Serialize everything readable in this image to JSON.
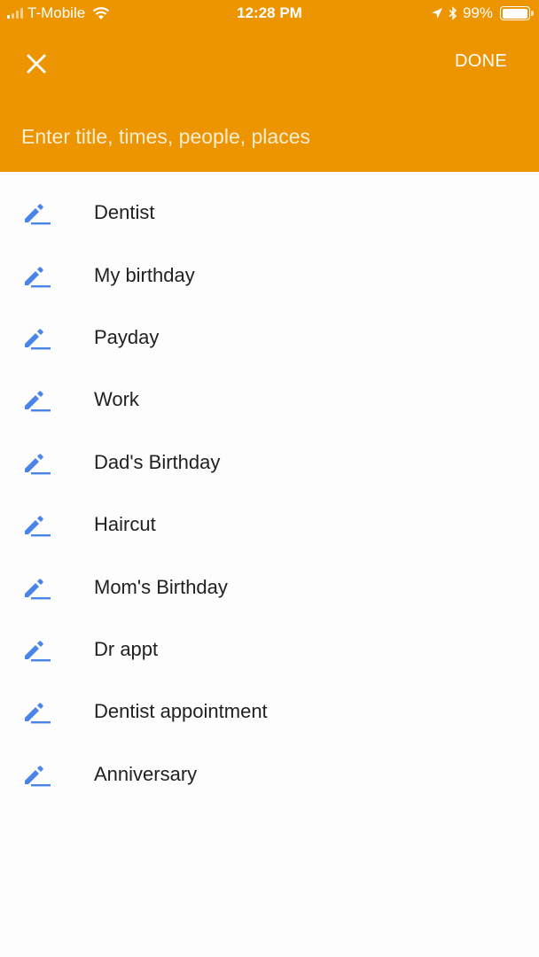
{
  "status_bar": {
    "carrier": "T-Mobile",
    "time": "12:28 PM",
    "battery_text": "99%",
    "battery_level": 0.99,
    "signal_bars_active": 1,
    "signal_bars_total": 4
  },
  "header": {
    "close_icon": "close-icon",
    "done_label": "DONE",
    "background_color": "#ed9500"
  },
  "title_input": {
    "placeholder": "Enter title, times, people, places",
    "value": ""
  },
  "suggestions": {
    "icon": "pencil-icon",
    "icon_color": "#4a84e8",
    "items": [
      {
        "label": "Dentist"
      },
      {
        "label": "My birthday"
      },
      {
        "label": "Payday"
      },
      {
        "label": "Work"
      },
      {
        "label": "Dad's Birthday"
      },
      {
        "label": "Haircut"
      },
      {
        "label": "Mom's Birthday"
      },
      {
        "label": "Dr appt"
      },
      {
        "label": "Dentist appointment"
      },
      {
        "label": "Anniversary"
      }
    ]
  }
}
